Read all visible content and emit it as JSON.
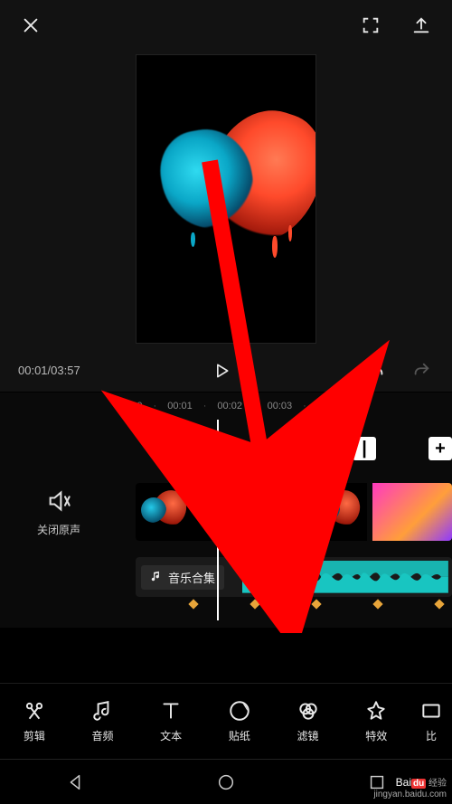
{
  "transport": {
    "current_time": "00:01",
    "total_time": "03:57",
    "time_display": "00:01/03:57"
  },
  "ruler": {
    "ticks": [
      "00:00",
      "00:01",
      "00:02",
      "00:03"
    ]
  },
  "mute": {
    "label": "关闭原声"
  },
  "audio_clip": {
    "label": "音乐合集"
  },
  "transition": {
    "left_label": "|",
    "right_label": "+"
  },
  "toolbar": {
    "items": [
      {
        "name": "edit",
        "label": "剪辑"
      },
      {
        "name": "audio",
        "label": "音频"
      },
      {
        "name": "text",
        "label": "文本"
      },
      {
        "name": "sticker",
        "label": "贴纸"
      },
      {
        "name": "filter",
        "label": "滤镜"
      },
      {
        "name": "effect",
        "label": "特效"
      },
      {
        "name": "ratio",
        "label": "比"
      }
    ]
  },
  "watermark": {
    "brand_a": "Bai",
    "brand_b": "du",
    "brand_c": "经验",
    "url": "jingyan.baidu.com"
  }
}
